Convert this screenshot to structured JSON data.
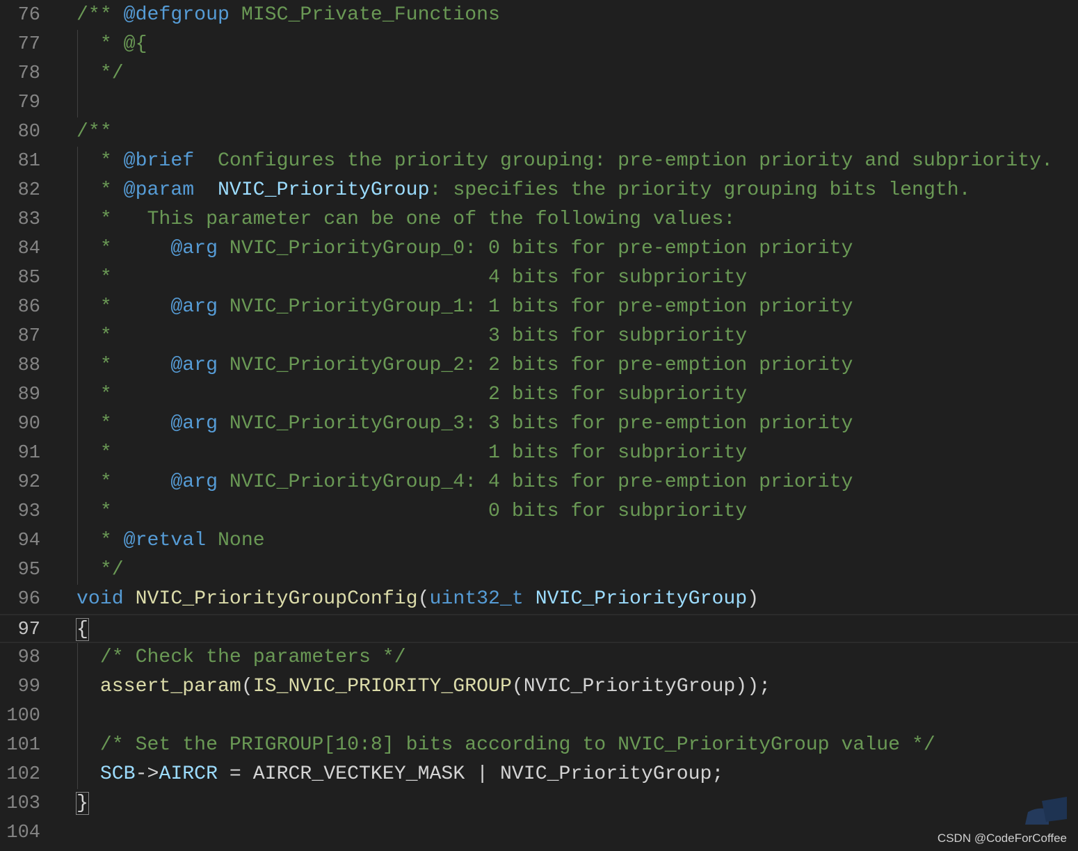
{
  "editor": {
    "current_line": 97,
    "lines": [
      {
        "n": "76",
        "tokens": [
          {
            "t": "/** ",
            "k": "comment"
          },
          {
            "t": "@defgroup",
            "k": "doctag"
          },
          {
            "t": " MISC_Private_Functions",
            "k": "comment"
          }
        ]
      },
      {
        "n": "77",
        "tokens": [
          {
            "t": "  * @{",
            "k": "comment"
          }
        ]
      },
      {
        "n": "78",
        "tokens": [
          {
            "t": "  */",
            "k": "comment"
          }
        ]
      },
      {
        "n": "79",
        "tokens": []
      },
      {
        "n": "80",
        "tokens": [
          {
            "t": "/**",
            "k": "comment"
          }
        ]
      },
      {
        "n": "81",
        "tokens": [
          {
            "t": "  * ",
            "k": "comment"
          },
          {
            "t": "@brief",
            "k": "doctag"
          },
          {
            "t": "  Configures the priority grouping: pre-emption priority and subpriority.",
            "k": "comment"
          }
        ]
      },
      {
        "n": "82",
        "tokens": [
          {
            "t": "  * ",
            "k": "comment"
          },
          {
            "t": "@param",
            "k": "doctag"
          },
          {
            "t": "  ",
            "k": "comment"
          },
          {
            "t": "NVIC_PriorityGroup",
            "k": "docparam"
          },
          {
            "t": ": specifies the priority grouping bits length.",
            "k": "comment"
          }
        ]
      },
      {
        "n": "83",
        "tokens": [
          {
            "t": "  *   This parameter can be one of the following values:",
            "k": "comment"
          }
        ]
      },
      {
        "n": "84",
        "tokens": [
          {
            "t": "  *     ",
            "k": "comment"
          },
          {
            "t": "@arg",
            "k": "doctag"
          },
          {
            "t": " NVIC_PriorityGroup_0: 0 bits for pre-emption priority",
            "k": "comment"
          }
        ]
      },
      {
        "n": "85",
        "tokens": [
          {
            "t": "  *                                4 bits for subpriority",
            "k": "comment"
          }
        ]
      },
      {
        "n": "86",
        "tokens": [
          {
            "t": "  *     ",
            "k": "comment"
          },
          {
            "t": "@arg",
            "k": "doctag"
          },
          {
            "t": " NVIC_PriorityGroup_1: 1 bits for pre-emption priority",
            "k": "comment"
          }
        ]
      },
      {
        "n": "87",
        "tokens": [
          {
            "t": "  *                                3 bits for subpriority",
            "k": "comment"
          }
        ]
      },
      {
        "n": "88",
        "tokens": [
          {
            "t": "  *     ",
            "k": "comment"
          },
          {
            "t": "@arg",
            "k": "doctag"
          },
          {
            "t": " NVIC_PriorityGroup_2: 2 bits for pre-emption priority",
            "k": "comment"
          }
        ]
      },
      {
        "n": "89",
        "tokens": [
          {
            "t": "  *                                2 bits for subpriority",
            "k": "comment"
          }
        ]
      },
      {
        "n": "90",
        "tokens": [
          {
            "t": "  *     ",
            "k": "comment"
          },
          {
            "t": "@arg",
            "k": "doctag"
          },
          {
            "t": " NVIC_PriorityGroup_3: 3 bits for pre-emption priority",
            "k": "comment"
          }
        ]
      },
      {
        "n": "91",
        "tokens": [
          {
            "t": "  *                                1 bits for subpriority",
            "k": "comment"
          }
        ]
      },
      {
        "n": "92",
        "tokens": [
          {
            "t": "  *     ",
            "k": "comment"
          },
          {
            "t": "@arg",
            "k": "doctag"
          },
          {
            "t": " NVIC_PriorityGroup_4: 4 bits for pre-emption priority",
            "k": "comment"
          }
        ]
      },
      {
        "n": "93",
        "tokens": [
          {
            "t": "  *                                0 bits for subpriority",
            "k": "comment"
          }
        ]
      },
      {
        "n": "94",
        "tokens": [
          {
            "t": "  * ",
            "k": "comment"
          },
          {
            "t": "@retval",
            "k": "doctag"
          },
          {
            "t": " None",
            "k": "comment"
          }
        ]
      },
      {
        "n": "95",
        "tokens": [
          {
            "t": "  */",
            "k": "comment"
          }
        ]
      },
      {
        "n": "96",
        "tokens": [
          {
            "t": "void",
            "k": "keyword"
          },
          {
            "t": " ",
            "k": "punct"
          },
          {
            "t": "NVIC_PriorityGroupConfig",
            "k": "func"
          },
          {
            "t": "(",
            "k": "punct"
          },
          {
            "t": "uint32_t",
            "k": "keyword"
          },
          {
            "t": " ",
            "k": "punct"
          },
          {
            "t": "NVIC_PriorityGroup",
            "k": "param"
          },
          {
            "t": ")",
            "k": "punct"
          }
        ]
      },
      {
        "n": "97",
        "tokens": [
          {
            "t": "{",
            "k": "brace"
          }
        ]
      },
      {
        "n": "98",
        "tokens": [
          {
            "t": "  ",
            "k": "punct"
          },
          {
            "t": "/* Check the parameters */",
            "k": "comment"
          }
        ]
      },
      {
        "n": "99",
        "tokens": [
          {
            "t": "  ",
            "k": "punct"
          },
          {
            "t": "assert_param",
            "k": "func"
          },
          {
            "t": "(",
            "k": "punct"
          },
          {
            "t": "IS_NVIC_PRIORITY_GROUP",
            "k": "func"
          },
          {
            "t": "(NVIC_PriorityGroup));",
            "k": "punct"
          }
        ]
      },
      {
        "n": "100",
        "tokens": []
      },
      {
        "n": "101",
        "tokens": [
          {
            "t": "  ",
            "k": "punct"
          },
          {
            "t": "/* Set the PRIGROUP[10:8] bits according to NVIC_PriorityGroup value */",
            "k": "comment"
          }
        ]
      },
      {
        "n": "102",
        "tokens": [
          {
            "t": "  ",
            "k": "punct"
          },
          {
            "t": "SCB",
            "k": "var"
          },
          {
            "t": "->",
            "k": "punct"
          },
          {
            "t": "AIRCR",
            "k": "var"
          },
          {
            "t": " = AIRCR_VECTKEY_MASK | NVIC_PriorityGroup;",
            "k": "punct"
          }
        ]
      },
      {
        "n": "103",
        "tokens": [
          {
            "t": "}",
            "k": "brace"
          }
        ]
      },
      {
        "n": "104",
        "tokens": []
      }
    ]
  },
  "watermark": {
    "text": "CSDN @CodeForCoffee"
  },
  "theme": {
    "background": "#1f1f1f",
    "comment": "#6a9955",
    "keyword": "#569cd6",
    "function": "#dcdcaa",
    "variable": "#9cdcfe",
    "text": "#d4d4d4"
  },
  "icons": {
    "scroll_indicator": "minimap-scroll-icon"
  }
}
